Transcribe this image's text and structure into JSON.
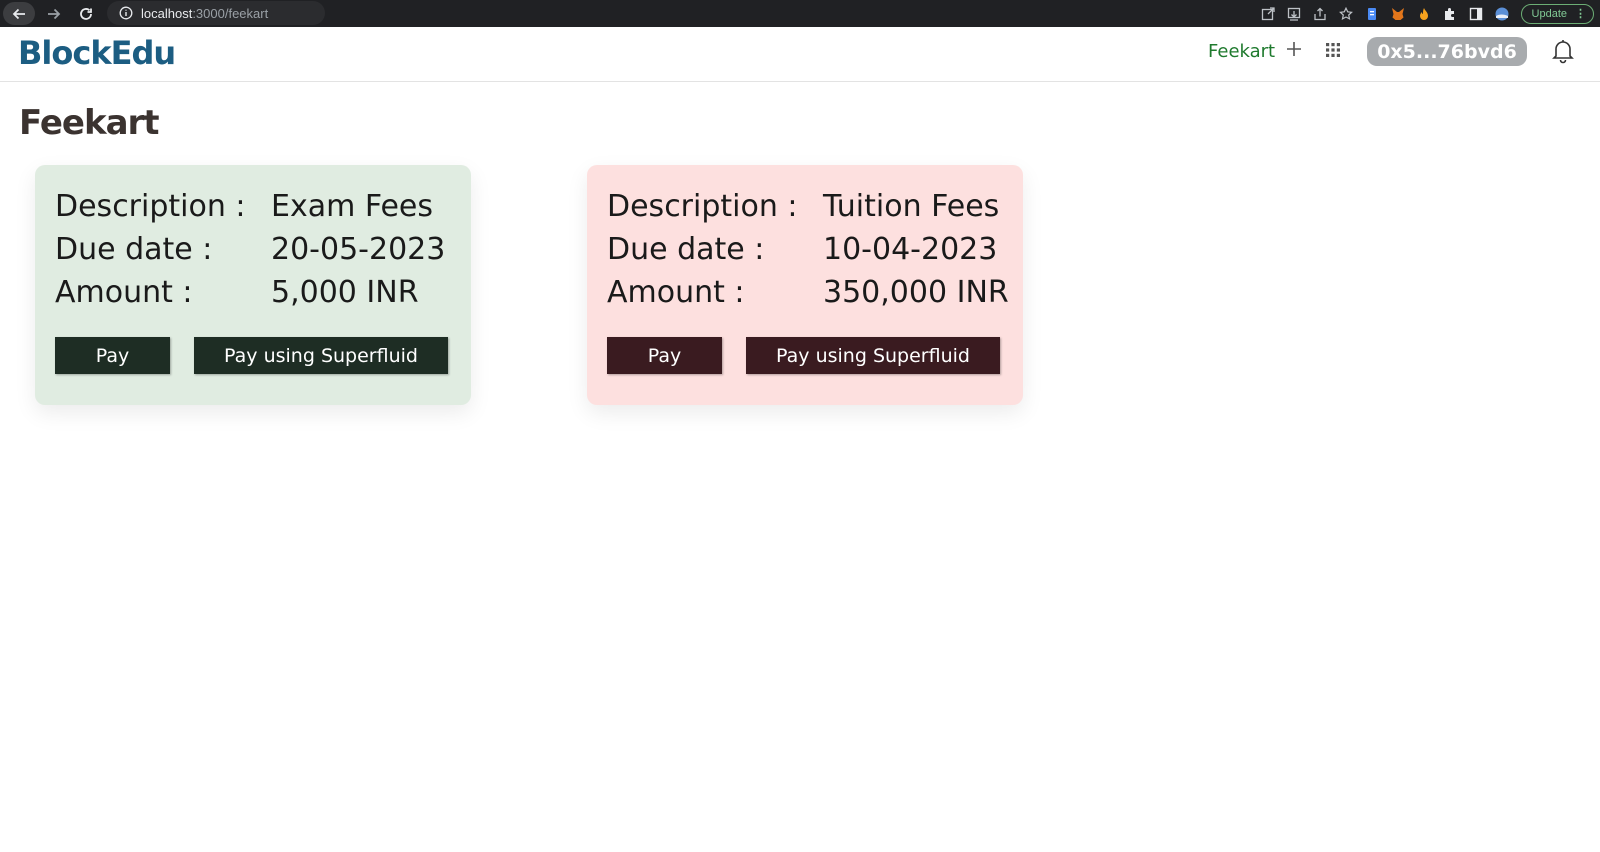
{
  "browser": {
    "url_host": "localhost",
    "url_rest": ":3000/feekart",
    "update_label": "Update"
  },
  "header": {
    "logo": "BlockEdu",
    "nav_link": "Feekart",
    "wallet": "0x5...76bvd6"
  },
  "page": {
    "title": "Feekart"
  },
  "fees": [
    {
      "description_label": "Description :",
      "description": "Exam Fees",
      "due_label": "Due date :",
      "due_date": "20-05-2023",
      "amount_label": "Amount :",
      "amount": "5,000 INR",
      "pay_label": "Pay",
      "superfluid_label": "Pay using Superfluid",
      "card_color": "#e0ece1",
      "button_color": "#1e2d24"
    },
    {
      "description_label": "Description :",
      "description": "Tuition Fees",
      "due_label": "Due date :",
      "due_date": "10-04-2023",
      "amount_label": "Amount :",
      "amount": "350,000 INR",
      "pay_label": "Pay",
      "superfluid_label": "Pay using Superfluid",
      "card_color": "#fde0df",
      "button_color": "#3a1b20"
    }
  ],
  "colors": {
    "brand": "#1c5d82",
    "nav_link": "#1f7a2e",
    "wallet_pill": "#a8abae",
    "title": "#3b3330"
  }
}
